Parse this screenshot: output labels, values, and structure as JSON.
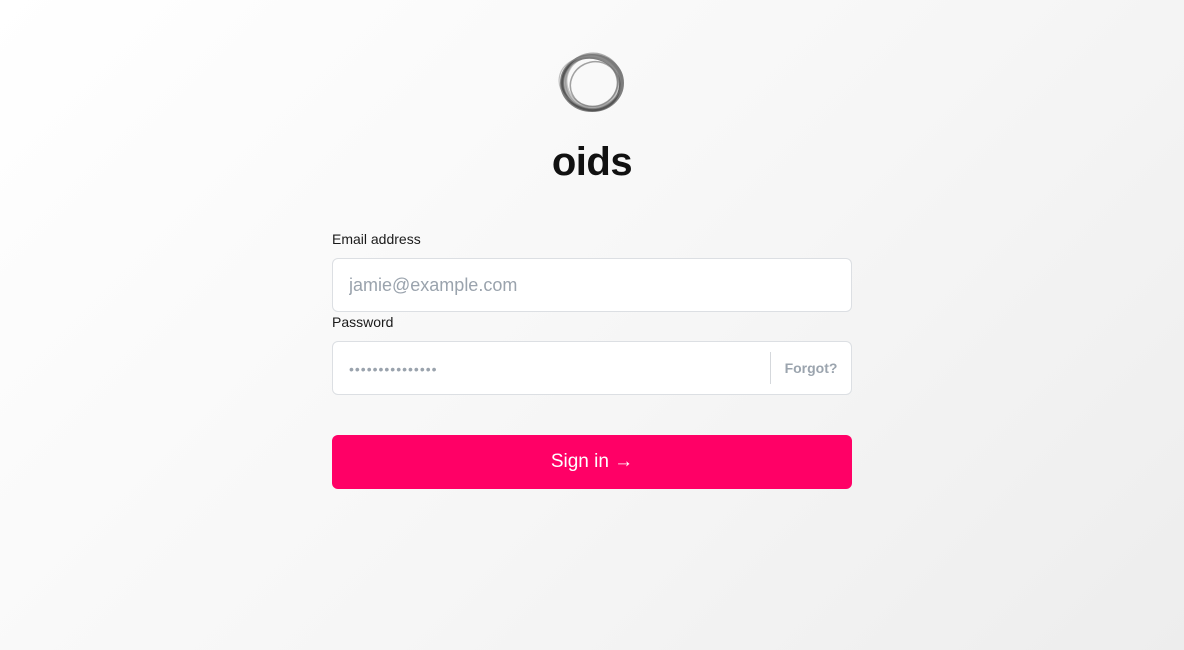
{
  "brand": {
    "logo_icon": "ring-logo-icon",
    "name": "oids"
  },
  "form": {
    "email": {
      "label": "Email address",
      "value": "",
      "placeholder": "jamie@example.com"
    },
    "password": {
      "label": "Password",
      "value": "",
      "placeholder": "•••••••••••••••",
      "forgot_label": "Forgot?"
    },
    "submit_label": "Sign in →"
  },
  "colors": {
    "accent": "#ff0066",
    "muted_text": "#9aa3ad",
    "border": "#dcdfe3"
  }
}
